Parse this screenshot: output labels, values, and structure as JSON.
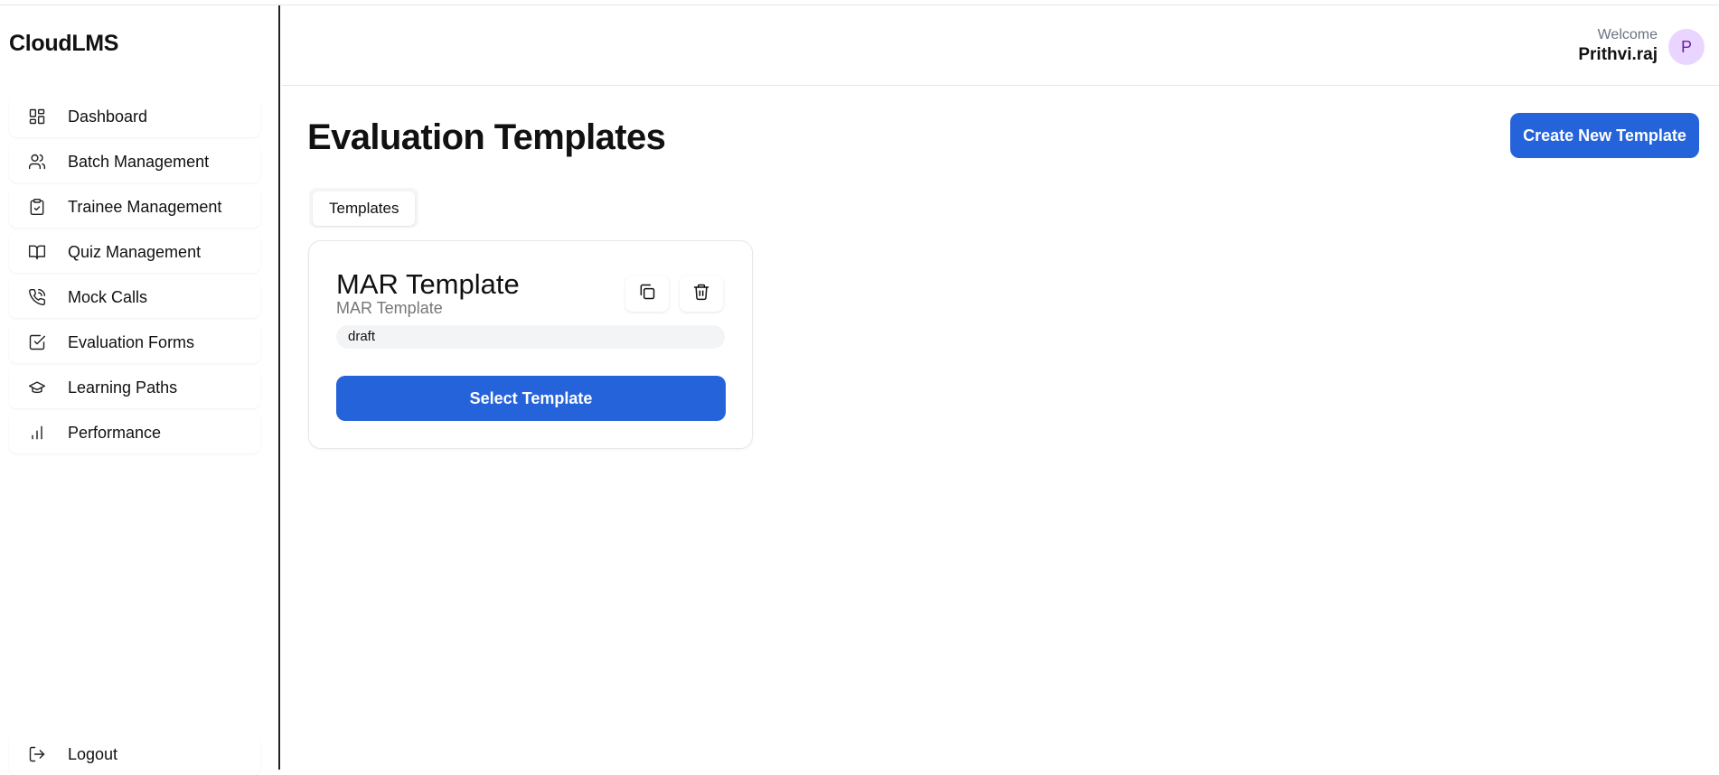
{
  "app": {
    "brand": "CloudLMS"
  },
  "sidebar": {
    "items": [
      {
        "label": "Dashboard",
        "icon": "dashboard-icon"
      },
      {
        "label": "Batch Management",
        "icon": "users-icon"
      },
      {
        "label": "Trainee Management",
        "icon": "clipboard-check-icon"
      },
      {
        "label": "Quiz Management",
        "icon": "book-open-icon"
      },
      {
        "label": "Mock Calls",
        "icon": "phone-call-icon"
      },
      {
        "label": "Evaluation Forms",
        "icon": "square-check-icon"
      },
      {
        "label": "Learning Paths",
        "icon": "graduation-cap-icon"
      },
      {
        "label": "Performance",
        "icon": "bar-chart-icon"
      }
    ],
    "logout": {
      "label": "Logout",
      "icon": "logout-icon"
    }
  },
  "header": {
    "welcome_label": "Welcome",
    "user_name": "Prithvi.raj",
    "avatar_initial": "P"
  },
  "main": {
    "title": "Evaluation Templates",
    "create_button": "Create New Template",
    "tabs": [
      {
        "label": "Templates"
      }
    ],
    "templates": [
      {
        "title": "MAR Template",
        "subtitle": "MAR Template",
        "status": "draft",
        "select_label": "Select Template"
      }
    ]
  },
  "colors": {
    "primary": "#2563db",
    "avatar_bg": "#e9d5ff",
    "avatar_text": "#6b21a8"
  }
}
